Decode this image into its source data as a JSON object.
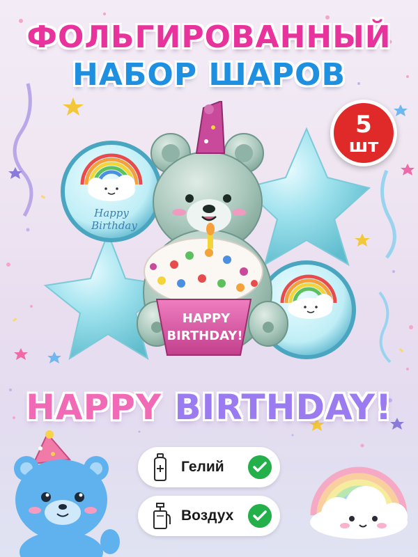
{
  "colors": {
    "title_pink": "#e8339c",
    "title_blue": "#1f8fe0",
    "badge_red": "#e02a2a",
    "foil_blue": "#8fdce8",
    "bear_green": "#a9c7bc",
    "cupcake_pink": "#d94f9f",
    "check_green": "#23b04a"
  },
  "title": {
    "line1": "ФОЛЬГИРОВАННЫЙ",
    "line2": "НАБОР ШАРОВ"
  },
  "quantity_badge": {
    "number": "5",
    "unit": "шт"
  },
  "balloons": {
    "round_balloon_text_line1": "Happy",
    "round_balloon_text_line2": "Birthday",
    "cupcake_text_line1": "HAPPY",
    "cupcake_text_line2": "BIRTHDAY!"
  },
  "headline": {
    "word1": "HAPPY",
    "word2": "BIRTHDAY!"
  },
  "features": [
    {
      "label": "Гелий",
      "icon": "gas-cylinder-icon",
      "checked": true
    },
    {
      "label": "Воздух",
      "icon": "air-pump-icon",
      "checked": true
    }
  ]
}
